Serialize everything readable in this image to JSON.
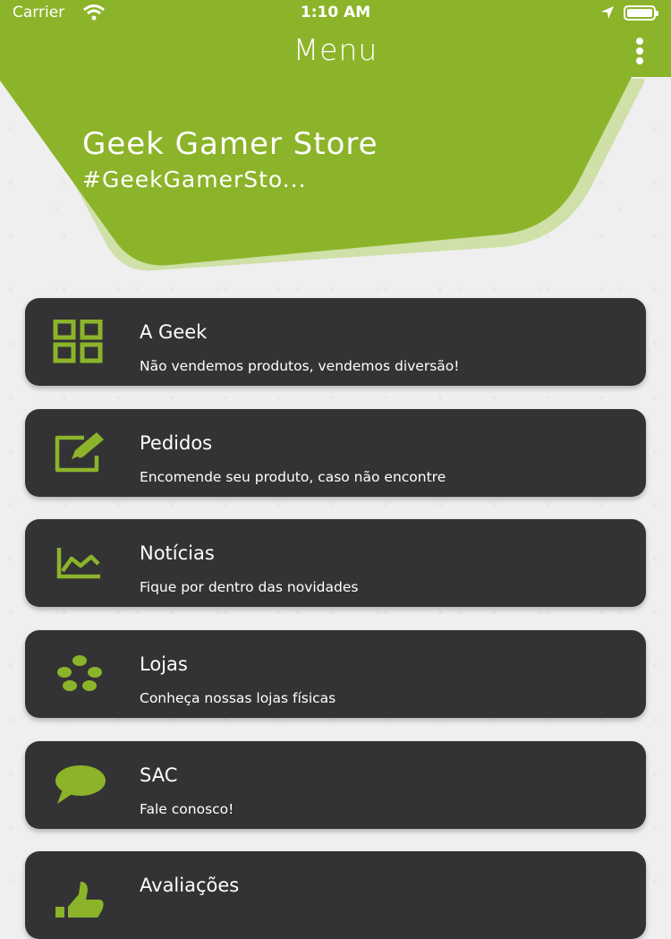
{
  "status_bar": {
    "carrier": "Carrier",
    "time": "1:10 AM"
  },
  "header": {
    "title": "Menu",
    "store_name": "Geek Gamer Store",
    "store_tag": "#GeekGamerSto..."
  },
  "colors": {
    "accent": "#8cb42a",
    "card_bg": "#333335",
    "background": "#efefef"
  },
  "menu_items": [
    {
      "title": "A Geek",
      "subtitle": "Não vendemos produtos, vendemos diversão!",
      "icon": "grid-icon"
    },
    {
      "title": "Pedidos",
      "subtitle": "Encomende seu produto, caso não encontre",
      "icon": "edit-icon"
    },
    {
      "title": "Notícias",
      "subtitle": "Fique por dentro das novidades",
      "icon": "chart-icon"
    },
    {
      "title": "Lojas",
      "subtitle": "Conheça nossas lojas físicas",
      "icon": "dots-icon"
    },
    {
      "title": "SAC",
      "subtitle": "Fale conosco!",
      "icon": "chat-icon"
    },
    {
      "title": "Avaliações",
      "subtitle": "",
      "icon": "thumbs-up-icon"
    }
  ]
}
